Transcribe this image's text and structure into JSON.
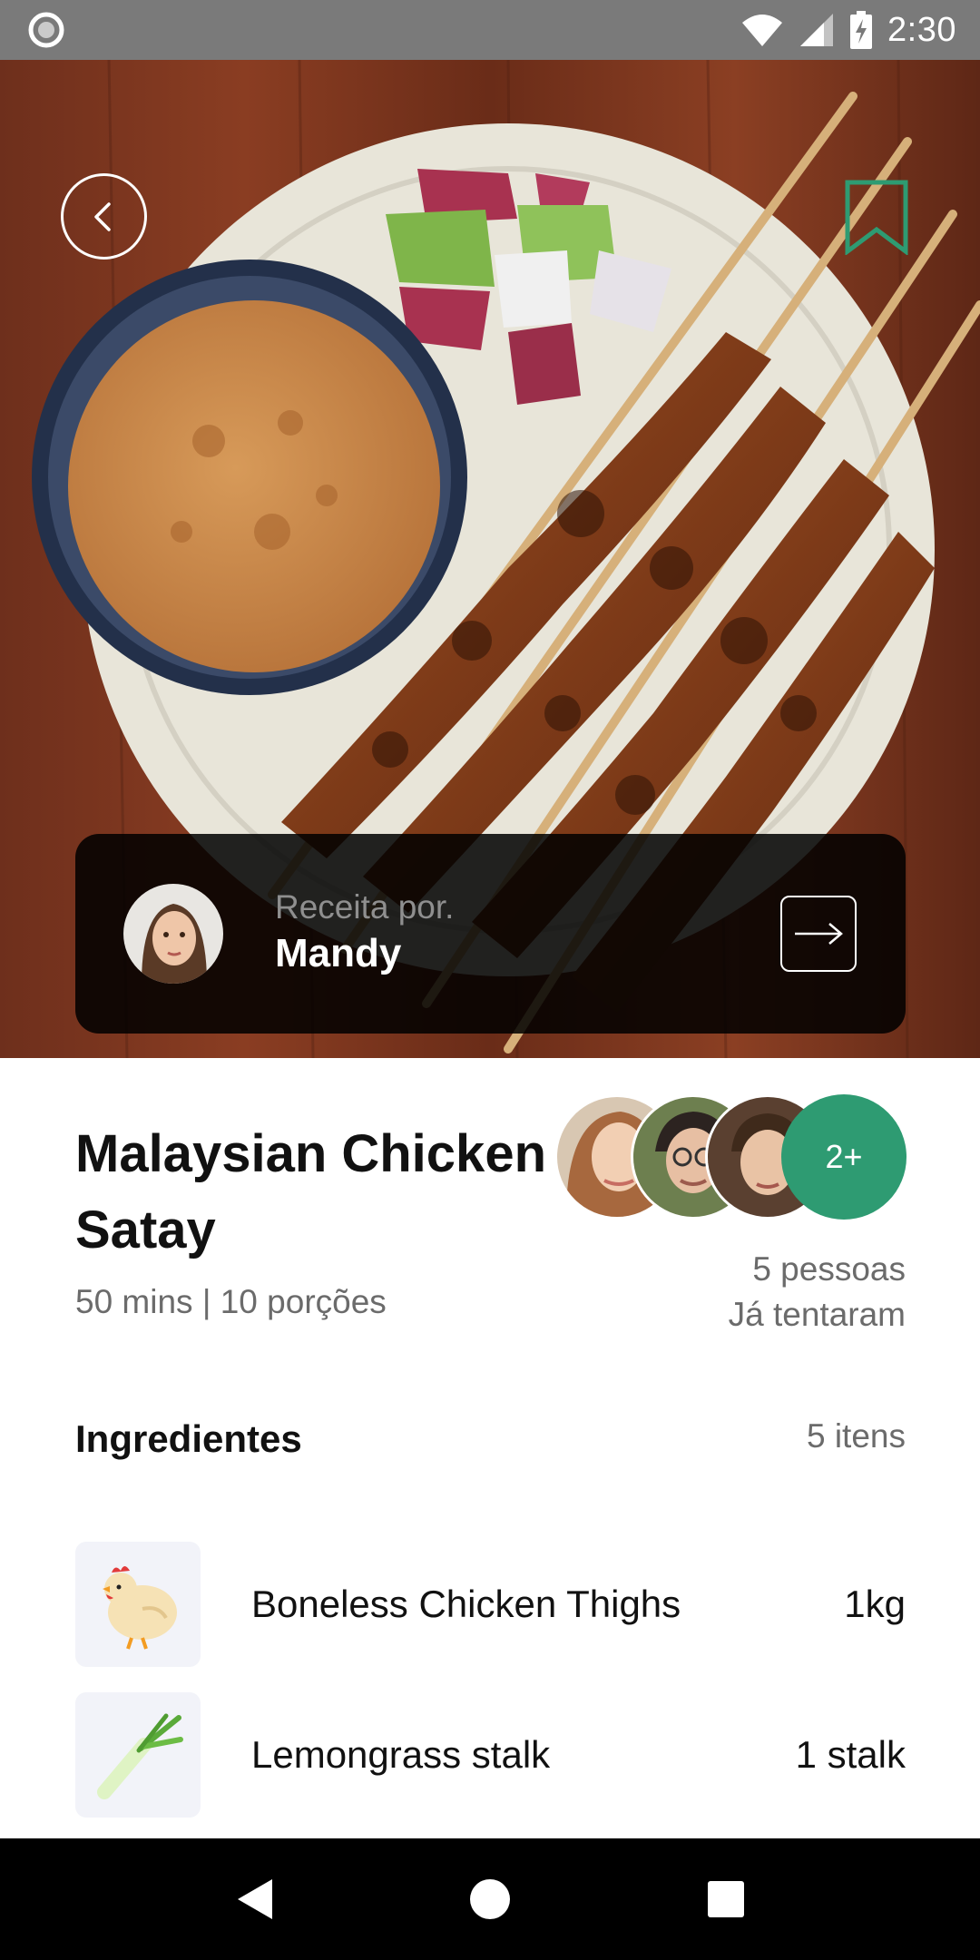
{
  "status_bar": {
    "time": "2:30",
    "icons": [
      "notification-dot-icon",
      "wifi-icon",
      "cell-signal-icon",
      "battery-charging-icon"
    ]
  },
  "hero": {
    "image": "chicken-satay-skewers-with-peanut-sauce",
    "back_icon": "chevron-left-icon",
    "bookmark_icon": "bookmark-icon",
    "accent_color": "#2e9b72"
  },
  "author": {
    "label": "Receita por.",
    "name": "Mandy",
    "arrow_icon": "arrow-right-box-icon"
  },
  "recipe": {
    "title": "Malaysian Chicken Satay",
    "meta": "50 mins | 10 porções"
  },
  "tried": {
    "more_badge": "2+",
    "count": "5 pessoas",
    "label": "Já tentaram"
  },
  "ingredients": {
    "header": "Ingredientes",
    "count": "5 itens",
    "items": [
      {
        "name": "Boneless Chicken Thighs",
        "qty": "1kg",
        "icon": "chicken-icon"
      },
      {
        "name": "Lemongrass stalk",
        "qty": "1 stalk",
        "icon": "lemongrass-icon"
      }
    ]
  },
  "nav": {
    "back": "nav-back-icon",
    "home": "nav-home-icon",
    "recents": "nav-recents-icon"
  }
}
